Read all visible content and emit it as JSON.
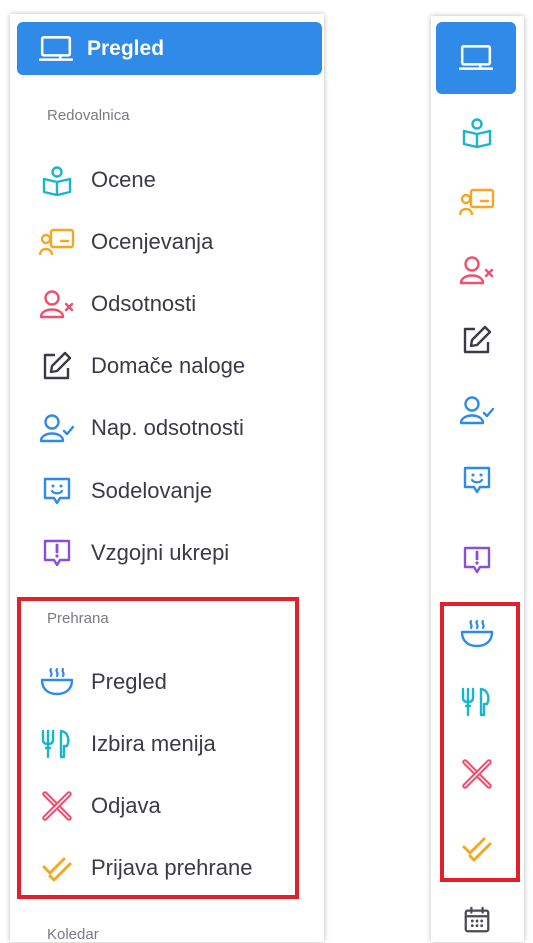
{
  "expanded": {
    "active": {
      "label": "Pregled",
      "icon": "classroom-board-icon"
    },
    "sections": [
      {
        "heading": "Redovalnica",
        "items": [
          {
            "label": "Ocene",
            "icon": "reading-student-icon",
            "color": "#19b5c9"
          },
          {
            "label": "Ocenjevanja",
            "icon": "teacher-board-icon",
            "color": "#f5a623"
          },
          {
            "label": "Odsotnosti",
            "icon": "user-x-icon",
            "color": "#f0506e"
          },
          {
            "label": "Domače naloge",
            "icon": "edit-note-icon",
            "color": "#3a3a48"
          },
          {
            "label": "Nap. odsotnosti",
            "icon": "user-check-icon",
            "color": "#2f8ae8"
          },
          {
            "label": "Sodelovanje",
            "icon": "smile-chat-icon",
            "color": "#2f8ae8"
          },
          {
            "label": "Vzgojni ukrepi",
            "icon": "alert-chat-icon",
            "color": "#8a4fd8"
          }
        ]
      },
      {
        "heading": "Prehrana",
        "items": [
          {
            "label": "Pregled",
            "icon": "steaming-bowl-icon",
            "color": "#2f8ae8"
          },
          {
            "label": "Izbira menija",
            "icon": "fork-knife-icon",
            "color": "#19b5c9"
          },
          {
            "label": "Odjava",
            "icon": "crossed-cutlery-icon",
            "color": "#f0506e"
          },
          {
            "label": "Prijava prehrane",
            "icon": "double-check-icon",
            "color": "#f5a623"
          }
        ]
      },
      {
        "heading": "Koledar",
        "items": []
      }
    ]
  },
  "collapsed": {
    "icons": [
      "classroom-board-icon",
      "reading-student-icon",
      "teacher-board-icon",
      "user-x-icon",
      "edit-note-icon",
      "user-check-icon",
      "smile-chat-icon",
      "alert-chat-icon",
      "steaming-bowl-icon",
      "fork-knife-icon",
      "crossed-cutlery-icon",
      "double-check-icon",
      "calendar-icon"
    ]
  },
  "colors": {
    "accent": "#2f8ae8",
    "highlight": "#e1202c"
  }
}
